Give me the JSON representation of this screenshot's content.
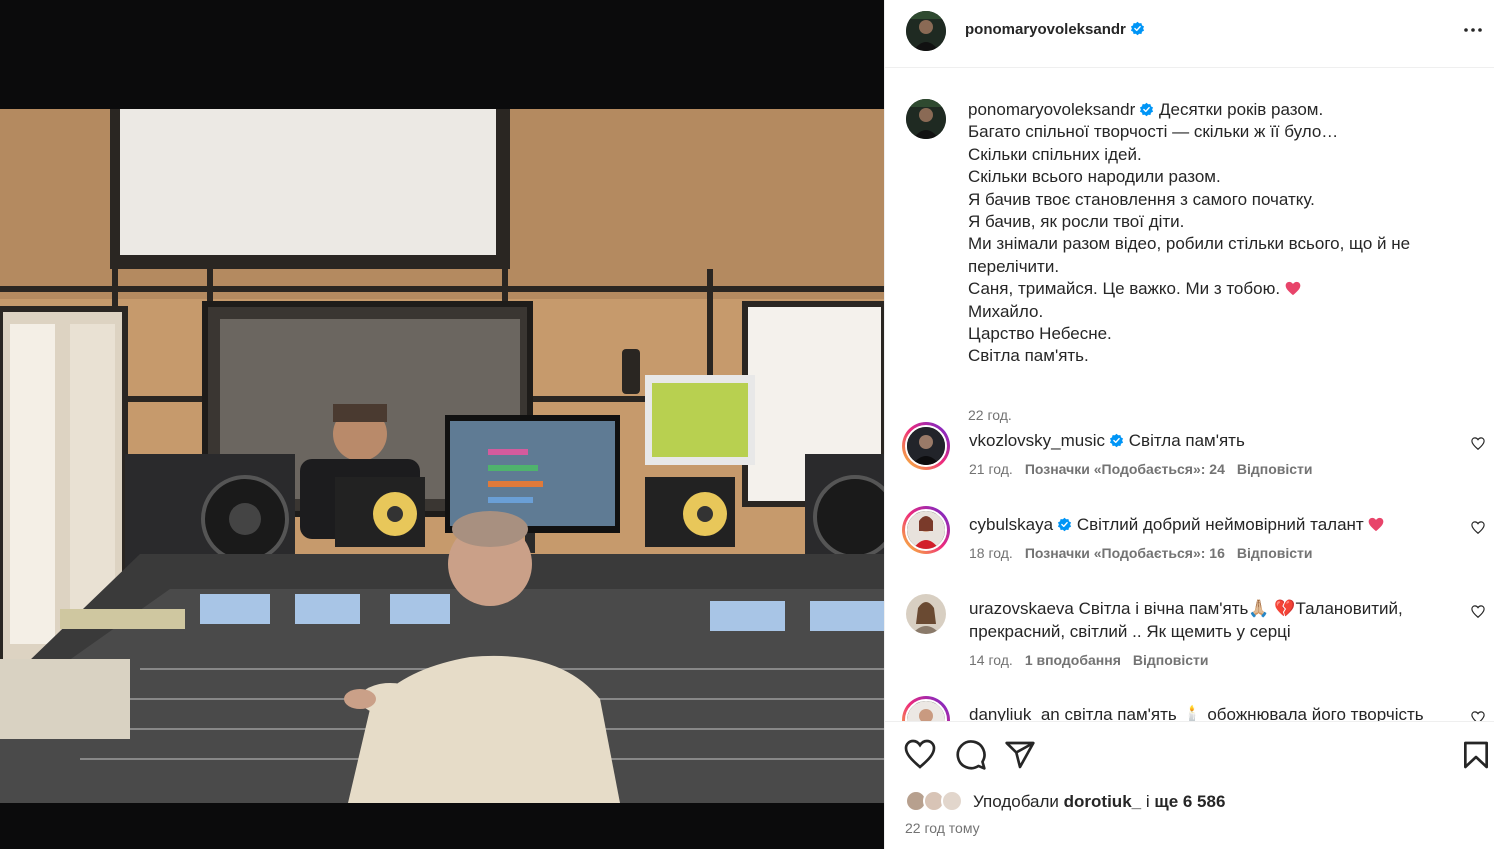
{
  "post": {
    "username": "ponomaryovoleksandr",
    "caption_lines": [
      "Десятки років разом.",
      "Багато спільної творчості — скільки ж її було…",
      "Скільки спільних ідей.",
      "Скільки всього народили разом.",
      "Я бачив твоє становлення з самого початку.",
      "Я бачив, як росли твої діти.",
      "Ми знімали разом відео, робили стільки всього, що й не перелічити.",
      "Саня, тримайся. Це важко. Ми з тобою.",
      "Михайло.",
      "Царство Небесне.",
      "Світла пам'ять."
    ],
    "caption_time": "22 год."
  },
  "comments": [
    {
      "username": "vkozlovsky_music",
      "text": "Світла пам'ять",
      "time": "21 год.",
      "likes": "Позначки «Подобається»: 24",
      "reply": "Відповісти"
    },
    {
      "username": "cybulskaya",
      "text": "Світлий добрий неймовірний талант",
      "time": "18 год.",
      "likes": "Позначки «Подобається»: 16",
      "reply": "Відповісти"
    },
    {
      "username": "urazovskaeva",
      "text": "Світла і вічна пам'ять🙏🏼 💔Талановитий, прекрасний, світлий .. Як щемить у серці",
      "time": "14 год.",
      "likes": "1 вподобання",
      "reply": "Відповісти"
    },
    {
      "username": "danyliuk_an",
      "text": "світла пам'ять 🕯️ обожнювала його творчість"
    }
  ],
  "footer": {
    "likes_prefix": "Уподобали",
    "likes_user": "dorotiuk_",
    "likes_mid": "і",
    "likes_count": "ще 6 586",
    "post_time": "22 год тому"
  },
  "icons": {
    "more": "more-horizontal-icon",
    "verified": "verified-badge-icon",
    "like": "heart-icon",
    "comment": "comment-icon",
    "share": "share-icon",
    "save": "bookmark-icon"
  },
  "colors": {
    "verified": "#0095f6",
    "text": "#262626",
    "secondary": "#737373",
    "emoji_heart": "#e8446a"
  }
}
